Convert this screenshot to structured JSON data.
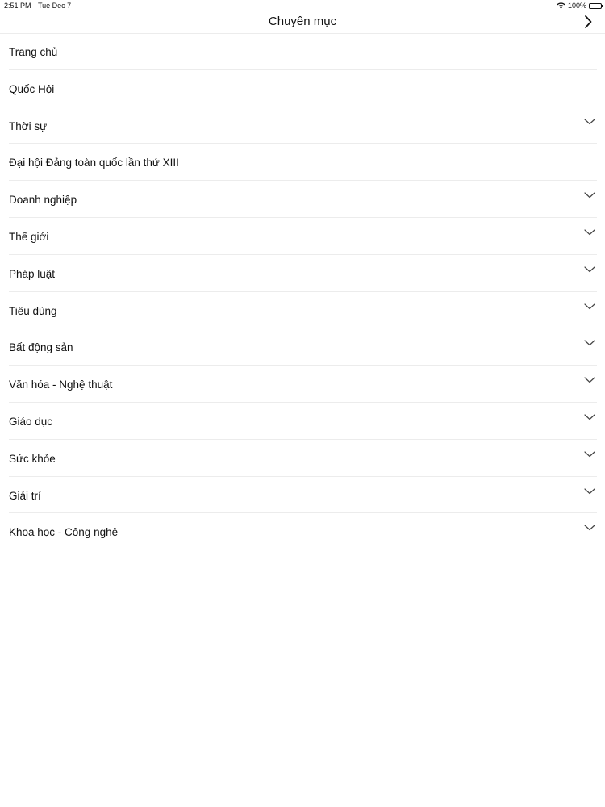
{
  "status_bar": {
    "time": "2:51 PM",
    "date": "Tue Dec 7",
    "battery": "100%"
  },
  "nav": {
    "title": "Chuyên mục"
  },
  "menu": {
    "items": [
      {
        "label": "Trang chủ",
        "expandable": false
      },
      {
        "label": "Quốc Hội",
        "expandable": false
      },
      {
        "label": "Thời sự",
        "expandable": true
      },
      {
        "label": "Đại hội Đảng toàn quốc lần thứ XIII",
        "expandable": false
      },
      {
        "label": "Doanh nghiệp",
        "expandable": true
      },
      {
        "label": "Thế giới",
        "expandable": true
      },
      {
        "label": "Pháp luật",
        "expandable": true
      },
      {
        "label": "Tiêu dùng",
        "expandable": true
      },
      {
        "label": "Bất động sản",
        "expandable": true
      },
      {
        "label": "Văn hóa - Nghệ thuật",
        "expandable": true
      },
      {
        "label": "Giáo dục",
        "expandable": true
      },
      {
        "label": "Sức khỏe",
        "expandable": true
      },
      {
        "label": "Giải trí",
        "expandable": true
      },
      {
        "label": "Khoa học - Công nghệ",
        "expandable": true
      }
    ]
  }
}
